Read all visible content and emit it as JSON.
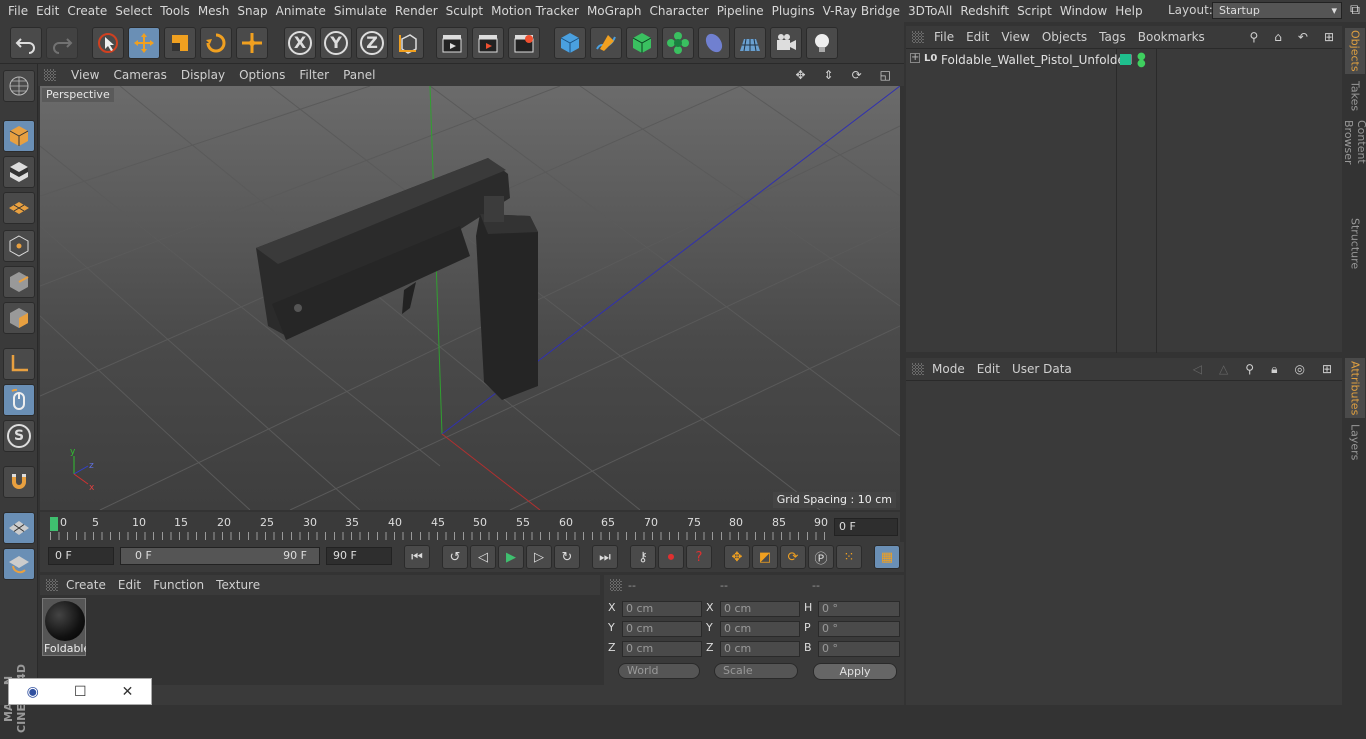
{
  "menubar": {
    "items": [
      "File",
      "Edit",
      "Create",
      "Select",
      "Tools",
      "Mesh",
      "Snap",
      "Animate",
      "Simulate",
      "Render",
      "Sculpt",
      "Motion Tracker",
      "MoGraph",
      "Character",
      "Pipeline",
      "Plugins",
      "V-Ray Bridge",
      "3DToAll",
      "Redshift",
      "Script",
      "Window",
      "Help"
    ],
    "layout_label": "Layout:",
    "layout_value": "Startup"
  },
  "toolbar": {
    "x_label": "X",
    "y_label": "Y",
    "z_label": "Z"
  },
  "leftbar": {
    "s_label": "S",
    "brand": "MAXON CINEMA 4D"
  },
  "viewport": {
    "menu": [
      "View",
      "Cameras",
      "Display",
      "Options",
      "Filter",
      "Panel"
    ],
    "camera_label": "Perspective",
    "grid_spacing": "Grid Spacing : 10 cm",
    "axis_x": "x",
    "axis_y": "y",
    "axis_z": "z"
  },
  "timeline": {
    "ticks": [
      "0",
      "5",
      "10",
      "15",
      "20",
      "25",
      "30",
      "35",
      "40",
      "45",
      "50",
      "55",
      "60",
      "65",
      "70",
      "75",
      "80",
      "85",
      "90"
    ],
    "current_frame": "0 F"
  },
  "controls": {
    "start_field": "0 F",
    "range_start": "0 F",
    "range_end": "90 F",
    "end_field": "90 F"
  },
  "material": {
    "menu": [
      "Create",
      "Edit",
      "Function",
      "Texture"
    ],
    "name": "Foldable"
  },
  "coords": {
    "headers": [
      "--",
      "--",
      "--"
    ],
    "rows": [
      {
        "l1": "X",
        "v1": "0 cm",
        "l2": "X",
        "v2": "0 cm",
        "l3": "H",
        "v3": "0 °"
      },
      {
        "l1": "Y",
        "v1": "0 cm",
        "l2": "Y",
        "v2": "0 cm",
        "l3": "P",
        "v3": "0 °"
      },
      {
        "l1": "Z",
        "v1": "0 cm",
        "l2": "Z",
        "v2": "0 cm",
        "l3": "B",
        "v3": "0 °"
      }
    ],
    "world": "World",
    "scale": "Scale",
    "apply": "Apply"
  },
  "objects": {
    "menu": [
      "File",
      "Edit",
      "View",
      "Objects",
      "Tags",
      "Bookmarks"
    ],
    "item_name": "Foldable_Wallet_Pistol_Unfolded",
    "layer_glyph": "L0"
  },
  "attributes": {
    "menu": [
      "Mode",
      "Edit",
      "User Data"
    ]
  },
  "right_tabs": [
    "Objects",
    "Takes",
    "Content Browser",
    "Structure",
    "Attributes",
    "Layers"
  ],
  "colors": {
    "accent": "#6a8fb5",
    "tag_green": "#1fc08e",
    "tab_active": "#e0a040"
  }
}
